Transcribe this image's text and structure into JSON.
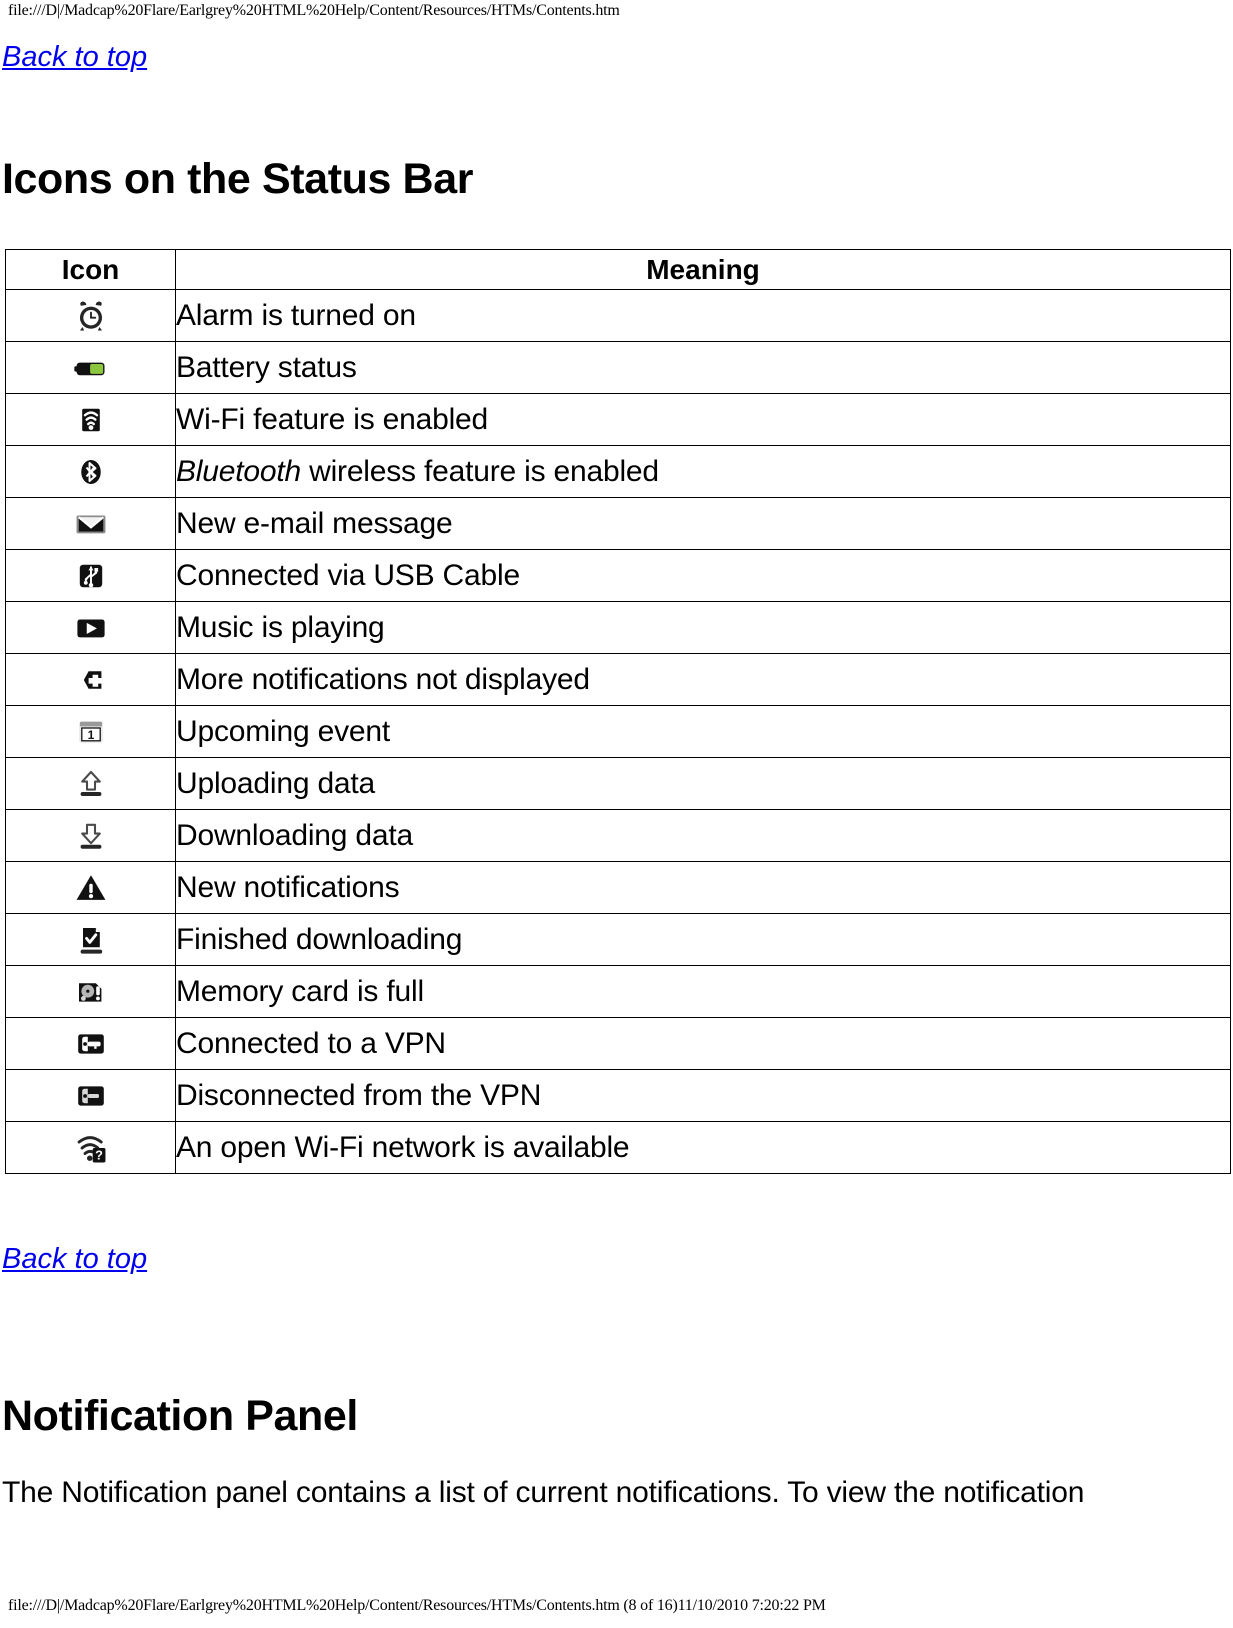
{
  "header": {
    "path": "file:///D|/Madcap%20Flare/Earlgrey%20HTML%20Help/Content/Resources/HTMs/Contents.htm"
  },
  "footer": {
    "path": "file:///D|/Madcap%20Flare/Earlgrey%20HTML%20Help/Content/Resources/HTMs/Contents.htm (8 of 16)11/10/2010 7:20:22 PM"
  },
  "links": {
    "back_to_top_1": "Back to top",
    "back_to_top_2": "Back to top"
  },
  "sections": {
    "status_bar_title": "Icons on the Status Bar",
    "notification_title": "Notification Panel",
    "notification_paragraph": "The Notification panel contains a list of current notifications. To view the notification"
  },
  "table": {
    "columns": [
      "Icon",
      "Meaning"
    ],
    "rows": [
      {
        "icon": "alarm-clock-icon",
        "meaning": "Alarm is turned on",
        "emphasis": ""
      },
      {
        "icon": "battery-icon",
        "meaning": "Battery status",
        "emphasis": ""
      },
      {
        "icon": "wifi-icon",
        "meaning": "Wi-Fi feature is enabled",
        "emphasis": ""
      },
      {
        "icon": "bluetooth-icon",
        "meaning": " wireless feature is enabled",
        "emphasis": "Bluetooth"
      },
      {
        "icon": "email-envelope-icon",
        "meaning": "New e-mail message",
        "emphasis": ""
      },
      {
        "icon": "usb-icon",
        "meaning": "Connected via USB Cable",
        "emphasis": ""
      },
      {
        "icon": "music-play-icon",
        "meaning": "Music is playing",
        "emphasis": ""
      },
      {
        "icon": "more-plus-icon",
        "meaning": "More notifications not displayed",
        "emphasis": ""
      },
      {
        "icon": "calendar-event-icon",
        "meaning": "Upcoming event",
        "emphasis": ""
      },
      {
        "icon": "upload-arrow-icon",
        "meaning": "Uploading data",
        "emphasis": ""
      },
      {
        "icon": "download-arrow-icon",
        "meaning": "Downloading data",
        "emphasis": ""
      },
      {
        "icon": "warning-triangle-icon",
        "meaning": "New notifications",
        "emphasis": ""
      },
      {
        "icon": "download-complete-icon",
        "meaning": "Finished downloading",
        "emphasis": ""
      },
      {
        "icon": "memory-card-full-icon",
        "meaning": "Memory card is full",
        "emphasis": ""
      },
      {
        "icon": "vpn-connected-icon",
        "meaning": "Connected to a VPN",
        "emphasis": ""
      },
      {
        "icon": "vpn-disconnected-icon",
        "meaning": "Disconnected from the VPN",
        "emphasis": ""
      },
      {
        "icon": "wifi-open-network-icon",
        "meaning": "An open Wi-Fi network is available",
        "emphasis": ""
      }
    ]
  },
  "colors": {
    "link": "#0000ee",
    "text": "#000000",
    "battery_green": "#8cc63e",
    "icon_dark": "#2b2b2b"
  }
}
